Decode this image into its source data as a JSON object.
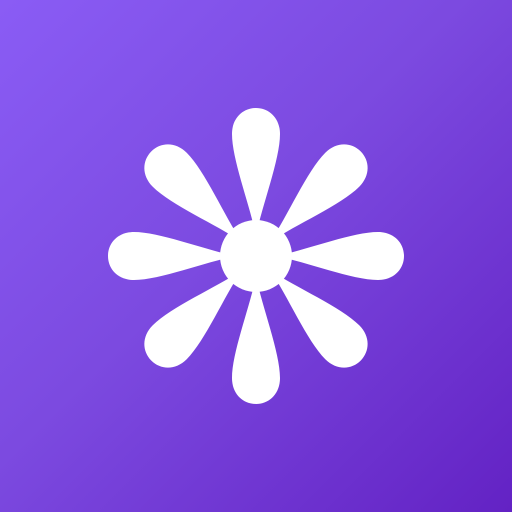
{
  "icon": {
    "name": "flower-logo-icon",
    "colors": {
      "background_start": "#8a5cf5",
      "background_mid": "#7c4ae0",
      "background_end": "#6322c4",
      "mark": "#ffffff"
    },
    "petal_count": 8
  }
}
